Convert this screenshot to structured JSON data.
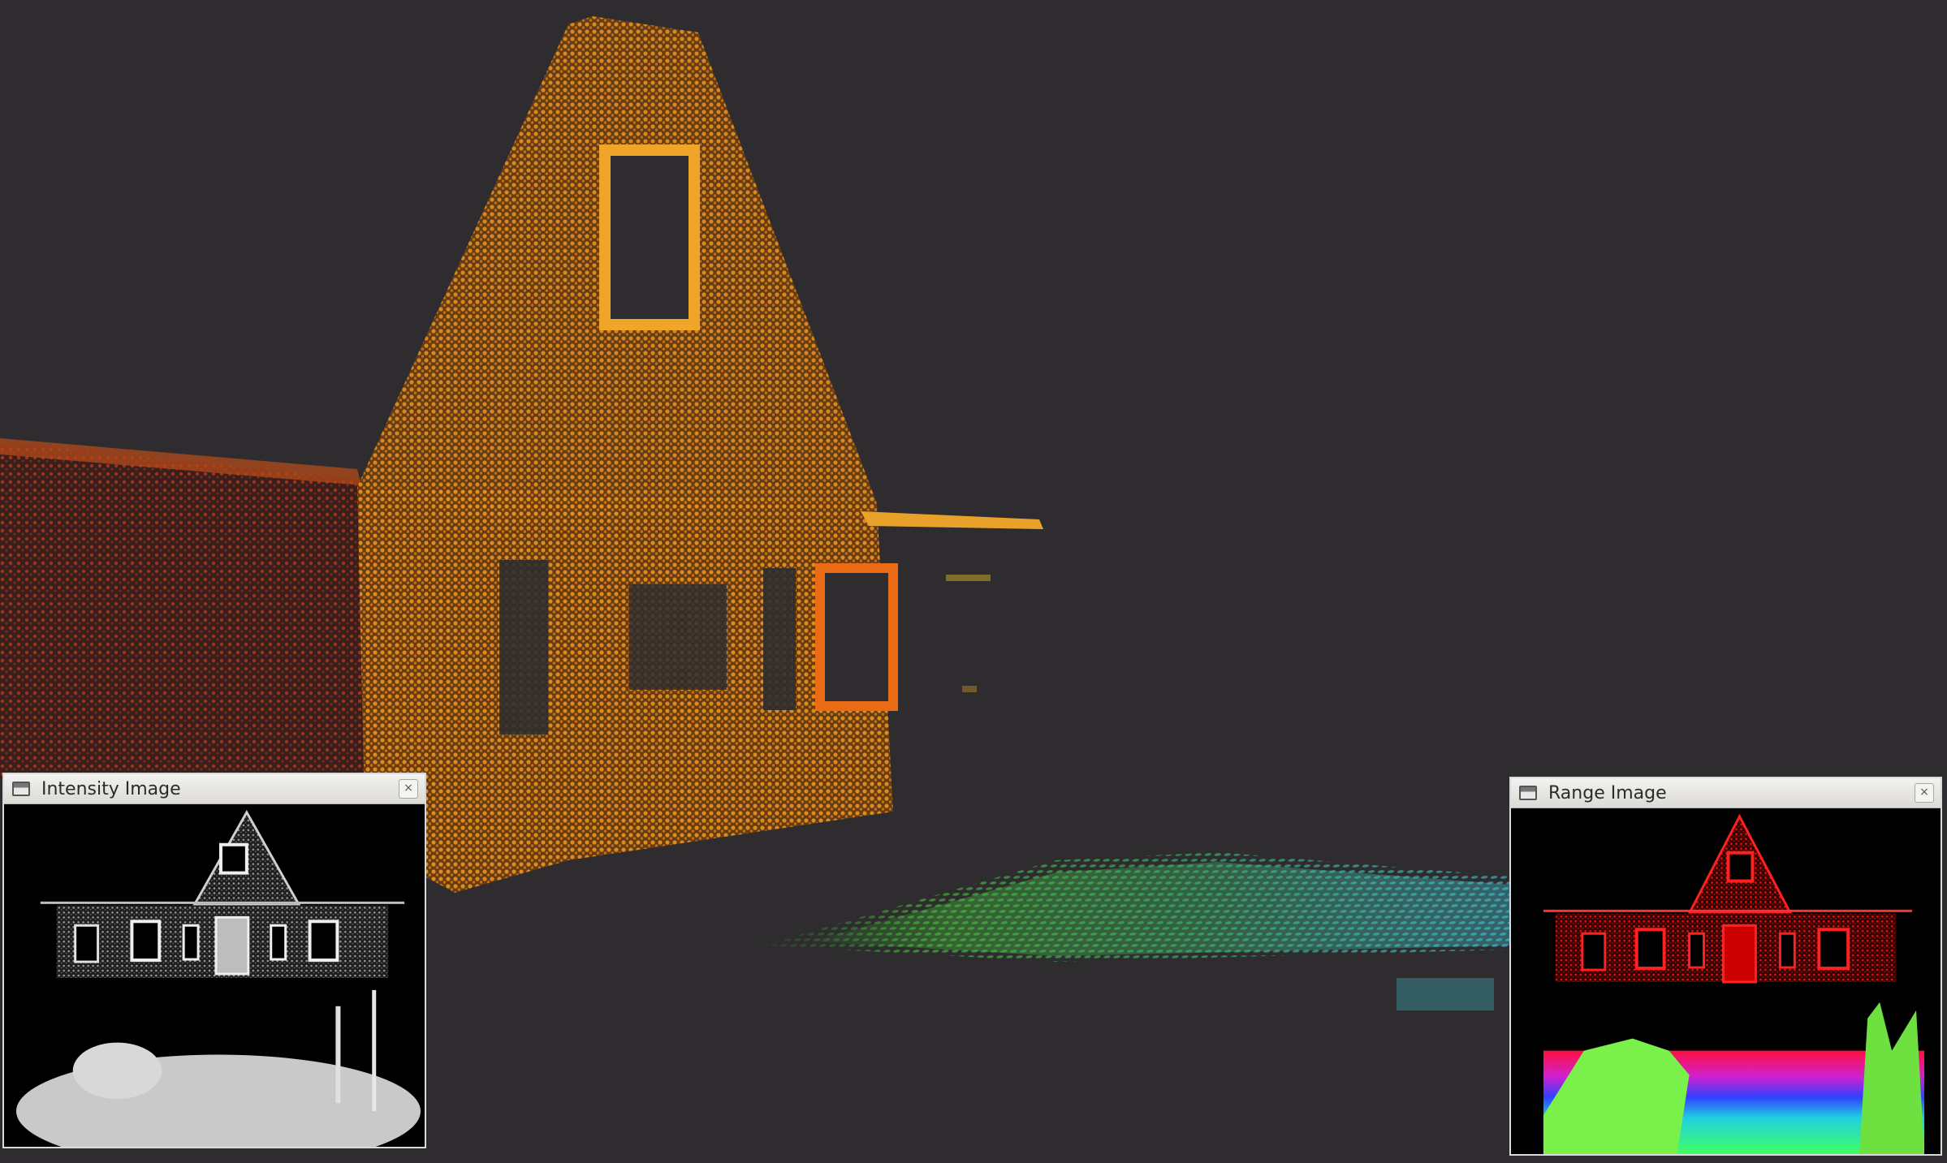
{
  "viewer": {
    "background": "#2f2c2f",
    "cloud_colors": {
      "house_front": "#e7901c",
      "house_front_bright": "#f0a528",
      "house_side": "#b3331b",
      "window_frame": "#ea6a16",
      "ground_near": "#46c63a",
      "ground_far": "#3fc7d2"
    }
  },
  "intensity_window": {
    "title": "Intensity Image",
    "close_label": "×",
    "icon": "window-icon"
  },
  "range_window": {
    "title": "Range Image",
    "close_label": "×",
    "icon": "window-icon"
  }
}
